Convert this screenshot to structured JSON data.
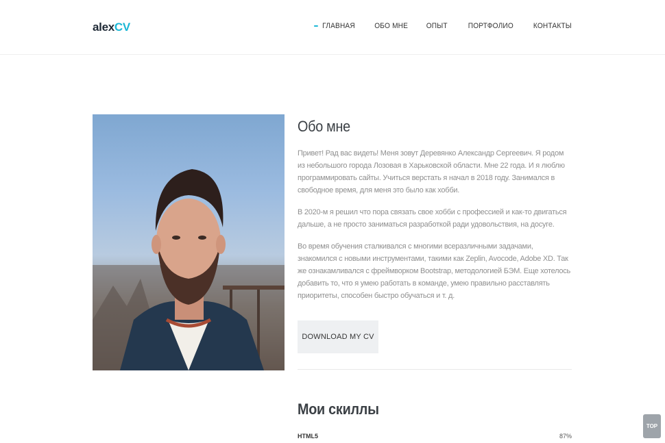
{
  "brand": {
    "part1": "alex",
    "part2": "CV",
    "accent_color": "#1ab7d6"
  },
  "nav": [
    {
      "label": "ГЛАВНАЯ",
      "active": true
    },
    {
      "label": "ОБО МНЕ"
    },
    {
      "label": "ОПЫТ"
    },
    {
      "label": "ПОРТФОЛИО"
    },
    {
      "label": "КОНТАКТЫ"
    }
  ],
  "about": {
    "title": "Обо мне",
    "paragraphs": [
      "Привет! Рад вас видеть! Меня зовут Деревянко Александр Сергеевич. Я родом из небольшого города Лозовая в Харьковской области. Мне 22 года. И я люблю программировать сайты. Учиться верстать я начал в 2018 году. Занимался в свободное время, для меня это было как хобби.",
      "В 2020-м я решил что пора связать свое хобби с профессией и как-то двигаться дальше, а не просто заниматься разработкой ради удовольствия, на досуге.",
      "Во время обучения сталкивался с многими всеразличными задачами, знакомился с новыми инструментами, такими как Zeplin, Avocode, Adobe XD. Так же ознакамливался с фреймворком Bootstrap, методологией БЭМ. Еще хотелось добавить то, что я умею работать в команде, умею правильно расставлять приоритеты, способен быстро обучаться и т. д."
    ],
    "download_label": "DOWNLOAD MY CV"
  },
  "skills": {
    "title": "Мои скиллы",
    "items": [
      {
        "name": "HTML5",
        "percent": "87%"
      }
    ]
  },
  "top_button": "TOP"
}
